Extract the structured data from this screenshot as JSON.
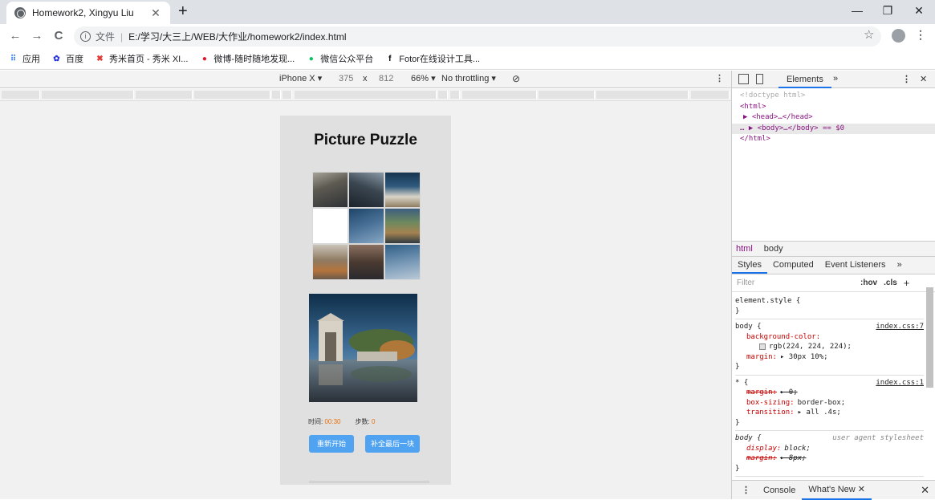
{
  "browser": {
    "tab_title": "Homework2, Xingyu Liu",
    "tab_close": "✕",
    "new_tab": "+",
    "minimize": "—",
    "restore": "❐",
    "close": "✕",
    "back": "←",
    "forward": "→",
    "reload": "C",
    "info": "i",
    "protocol_label": "文件",
    "url": "E:/学习/大三上/WEB/大作业/homework2/index.html",
    "star": "☆",
    "menu": "⋮"
  },
  "bookmarks": [
    {
      "label": "应用",
      "icon": "apps-grid-icon",
      "color": "#4285f4",
      "glyph": "⠿"
    },
    {
      "label": "百度",
      "icon": "baidu-paw-icon",
      "color": "#2932e1",
      "glyph": "✿"
    },
    {
      "label": "秀米首页 - 秀米 XI...",
      "icon": "xiumi-icon",
      "color": "#e53935",
      "glyph": "✖"
    },
    {
      "label": "微博-随时随地发现...",
      "icon": "weibo-icon",
      "color": "#e6162d",
      "glyph": "●"
    },
    {
      "label": "微信公众平台",
      "icon": "wechat-icon",
      "color": "#07c160",
      "glyph": "●"
    },
    {
      "label": "Fotor在线设计工具...",
      "icon": "fotor-icon",
      "color": "#000000",
      "glyph": "f"
    }
  ],
  "device_toolbar": {
    "device": "iPhone X ▾",
    "width": "375",
    "times": "x",
    "height": "812",
    "zoom": "66% ▾",
    "throttling": "No throttling ▾",
    "rotate": "⊘",
    "more": "⋮"
  },
  "page": {
    "title": "Picture Puzzle",
    "time_label": "时间:",
    "time_value": "00:30",
    "steps_label": "步数:",
    "steps_value": "0",
    "restart_button": "重新开始",
    "finish_button": "补全最后一块"
  },
  "devtools": {
    "elements_tab": "Elements",
    "more_tabs": "»",
    "menu": "⋮",
    "close": "✕",
    "dom": [
      {
        "text": "<!doctype html>",
        "gray": true
      },
      {
        "text": "<html>"
      },
      {
        "text": "▶ <head>…</head>",
        "indent": 1
      },
      {
        "text": "… ▶ <body>…</body> == $0",
        "highlight": true
      },
      {
        "text": "</html>"
      }
    ],
    "breadcrumbs": [
      "html",
      "body"
    ],
    "style_tabs": [
      "Styles",
      "Computed",
      "Event Listeners",
      "»"
    ],
    "filter_placeholder": "Filter",
    "hov": ":hov",
    "cls": ".cls",
    "plus": "+",
    "rules": [
      {
        "selector": "element.style {",
        "source": "",
        "lines": [],
        "close": "}"
      },
      {
        "selector": "body {",
        "source": "index.css:7",
        "lines": [
          {
            "prop": "background-color:",
            "val": ""
          },
          {
            "prop": "",
            "val": "rgb(224, 224, 224);",
            "swatch": true
          },
          {
            "prop": "margin:",
            "val": "▸ 30px 10%;"
          }
        ],
        "close": "}"
      },
      {
        "selector": "* {",
        "source": "index.css:1",
        "lines": [
          {
            "prop": "margin:",
            "val": "▸ 0;",
            "strike": true
          },
          {
            "prop": "box-sizing:",
            "val": "border-box;"
          },
          {
            "prop": "transition:",
            "val": "▸ all .4s;"
          }
        ],
        "close": "}"
      },
      {
        "selector": "body {",
        "source": "user agent stylesheet",
        "ua": true,
        "lines": [
          {
            "prop": "display:",
            "val": "block;",
            "italic": true
          },
          {
            "prop": "margin:",
            "val": "▸ 8px;",
            "strike": true,
            "italic": true
          }
        ],
        "close": "}"
      }
    ],
    "drawer_tabs": [
      "Console",
      "What's New ✕"
    ],
    "drawer_close": "✕"
  }
}
